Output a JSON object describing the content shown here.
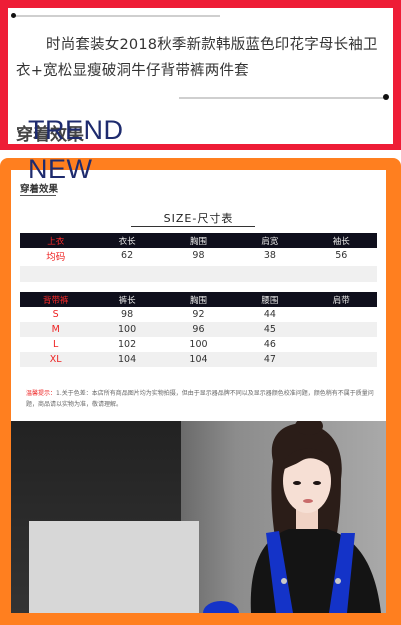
{
  "product": {
    "title": "时尚套装女2018秋季新款韩版蓝色印花字母长袖卫衣+宽松显瘦破洞牛仔背带裤两件套"
  },
  "section": {
    "heading": "穿着效果"
  },
  "size_chart": {
    "heading": "穿着效果",
    "title": "SIZE-尺寸表",
    "top_table": {
      "headers": [
        "上衣",
        "衣长",
        "胸围",
        "肩宽",
        "袖长"
      ],
      "rows": [
        [
          "均码",
          "62",
          "98",
          "38",
          "56"
        ]
      ]
    },
    "bottom_table": {
      "headers": [
        "背带裤",
        "裤长",
        "胸围",
        "腰围",
        "肩带"
      ],
      "rows": [
        [
          "S",
          "98",
          "92",
          "44",
          ""
        ],
        [
          "M",
          "100",
          "96",
          "45",
          ""
        ],
        [
          "L",
          "102",
          "100",
          "46",
          ""
        ],
        [
          "XL",
          "104",
          "104",
          "47",
          ""
        ]
      ]
    },
    "note_label": "温馨提示：",
    "note_text": "1.关于色差：本店所有商品图片均为实物拍摄，但由于显示器品牌不同以及显示器颜色校准问题，颜色稍有不属于质量问题，商品请以实物为准，敬请理解。"
  },
  "photo": {
    "sign_line1": "TREND",
    "sign_line2": "NEW"
  },
  "colors": {
    "top_frame": "#ee1d36",
    "image_frame": "#ff7f1f",
    "table_header_bg": "#0f0f1c",
    "size_label": "#ee2222",
    "overall_blue": "#1433c8"
  }
}
